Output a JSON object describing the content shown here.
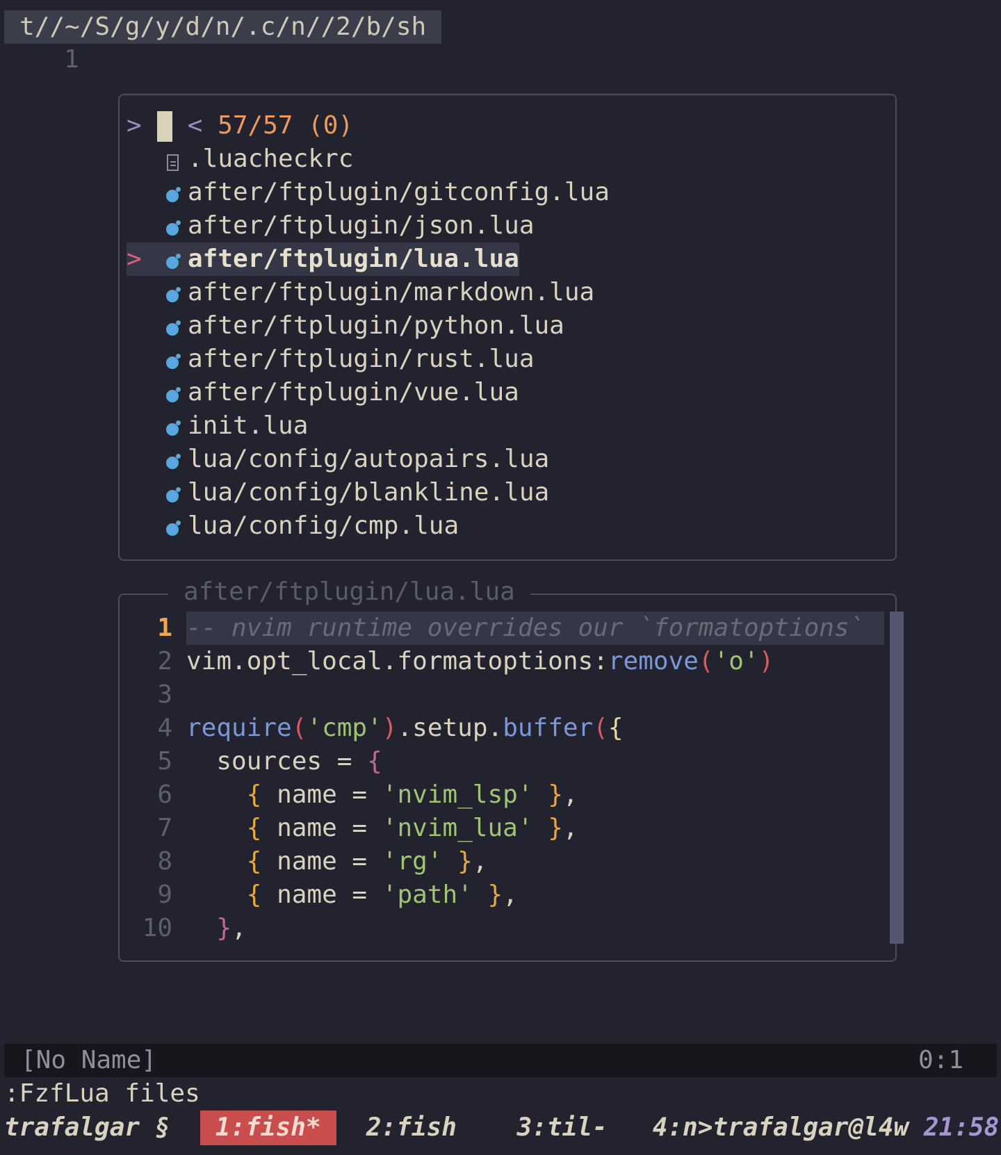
{
  "tabline": {
    "path": "t//~/S/g/y/d/n/.c/n//2/b/sh"
  },
  "buffer": {
    "line_number": "1"
  },
  "picker": {
    "prompt_symbol": ">",
    "count_prefix": "<",
    "count": "57/57 (0)",
    "selected_marker": ">",
    "files": [
      {
        "icon": "doc-icon",
        "name": ".luacheckrc"
      },
      {
        "icon": "lua-icon",
        "name": "after/ftplugin/gitconfig.lua"
      },
      {
        "icon": "lua-icon",
        "name": "after/ftplugin/json.lua"
      },
      {
        "icon": "lua-icon",
        "name": "after/ftplugin/lua.lua",
        "selected": true
      },
      {
        "icon": "lua-icon",
        "name": "after/ftplugin/markdown.lua"
      },
      {
        "icon": "lua-icon",
        "name": "after/ftplugin/python.lua"
      },
      {
        "icon": "lua-icon",
        "name": "after/ftplugin/rust.lua"
      },
      {
        "icon": "lua-icon",
        "name": "after/ftplugin/vue.lua"
      },
      {
        "icon": "lua-icon",
        "name": "init.lua"
      },
      {
        "icon": "lua-icon",
        "name": "lua/config/autopairs.lua"
      },
      {
        "icon": "lua-icon",
        "name": "lua/config/blankline.lua"
      },
      {
        "icon": "lua-icon",
        "name": "lua/config/cmp.lua"
      }
    ]
  },
  "preview": {
    "title": "after/ftplugin/lua.lua",
    "line_numbers": [
      "1",
      "2",
      "3",
      "4",
      "5",
      "6",
      "7",
      "8",
      "9",
      "10"
    ],
    "code": {
      "l1": "-- nvim runtime overrides our `formatoptions`",
      "l2_obj": "vim.opt_local.formatoptions:",
      "l2_fn": "remove",
      "l2_open": "(",
      "l2_str": "'o'",
      "l2_close": ")",
      "l4_fn": "require",
      "l4_open": "(",
      "l4_str": "'cmp'",
      "l4_close": ")",
      "l4_mid": ".setup.",
      "l4_fn2": "buffer",
      "l4_open2": "(",
      "l4_brace": "{",
      "l5_key": "  sources = ",
      "l5_brace": "{",
      "l6_indent": "    ",
      "l6_open": "{",
      "l6_key": " name = ",
      "l6_str": "'nvim_lsp'",
      "l6_close": " }",
      "l6_tail": ",",
      "l7_indent": "    ",
      "l7_open": "{",
      "l7_key": " name = ",
      "l7_str": "'nvim_lua'",
      "l7_close": " }",
      "l7_tail": ",",
      "l8_indent": "    ",
      "l8_open": "{",
      "l8_key": " name = ",
      "l8_str": "'rg'",
      "l8_close": " }",
      "l8_tail": ",",
      "l9_indent": "    ",
      "l9_open": "{",
      "l9_key": " name = ",
      "l9_str": "'path'",
      "l9_close": " }",
      "l9_tail": ",",
      "l10_indent": "  ",
      "l10_brace": "}",
      "l10_tail": ","
    }
  },
  "statusline": {
    "left": "[No Name]",
    "right": "0:1"
  },
  "cmdline": ":FzfLua files",
  "tmux": {
    "session": "trafalgar §",
    "windows": [
      {
        "label": "1:fish*",
        "active": true
      },
      {
        "label": "2:fish"
      },
      {
        "label": "3:til-"
      },
      {
        "label": "4:n>trafalgar@l4w"
      }
    ],
    "clock": "21:58"
  },
  "colors": {
    "background": "#22232e",
    "accent_orange": "#ed9a5c",
    "lua_icon": "#56a8dd",
    "active_window": "#c94d4d",
    "string": "#9ec474",
    "function": "#7b97d8"
  }
}
